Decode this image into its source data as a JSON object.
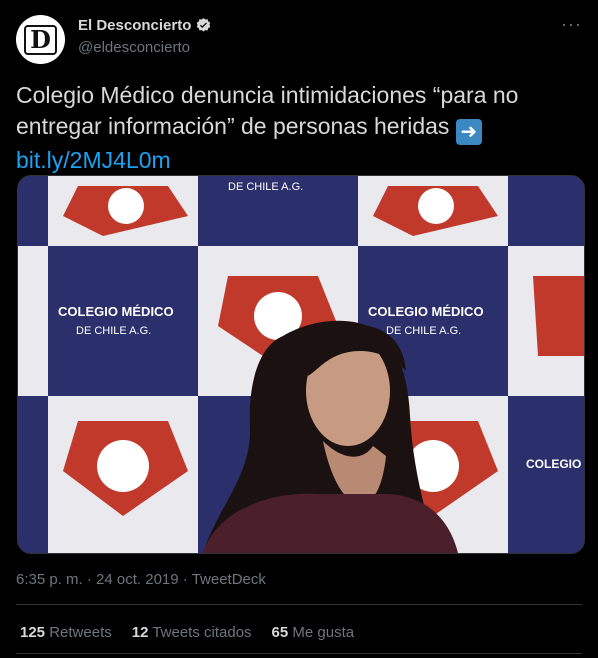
{
  "account": {
    "display_name": "El Desconcierto",
    "handle": "@eldesconcierto",
    "avatar_letter": "D",
    "verified_icon": "verified-badge-icon"
  },
  "more_label": "···",
  "tweet": {
    "text": "Colegio Médico denuncia intimidaciones “para no entregar información” de personas heridas",
    "emoji_glyph": "➜",
    "link": "bit.ly/2MJ4L0m"
  },
  "media": {
    "backdrop_text_1": "COLEGIO MÉDICO",
    "backdrop_text_2": "DE CHILE A.G.",
    "backdrop_text_3": "COLEGIO",
    "backdrop_text_4": "DE CHILE A.G."
  },
  "meta": {
    "time": "6:35 p. m.",
    "sep": "·",
    "date": "24 oct. 2019",
    "source": "TweetDeck"
  },
  "stats": [
    {
      "count": "125",
      "label": "Retweets"
    },
    {
      "count": "12",
      "label": "Tweets citados"
    },
    {
      "count": "65",
      "label": "Me gusta"
    }
  ],
  "colors": {
    "background": "#000000",
    "link": "#1da1f2",
    "muted": "#6e767d",
    "backdrop_blue": "#2b2f6b",
    "backdrop_red": "#c0392b"
  }
}
